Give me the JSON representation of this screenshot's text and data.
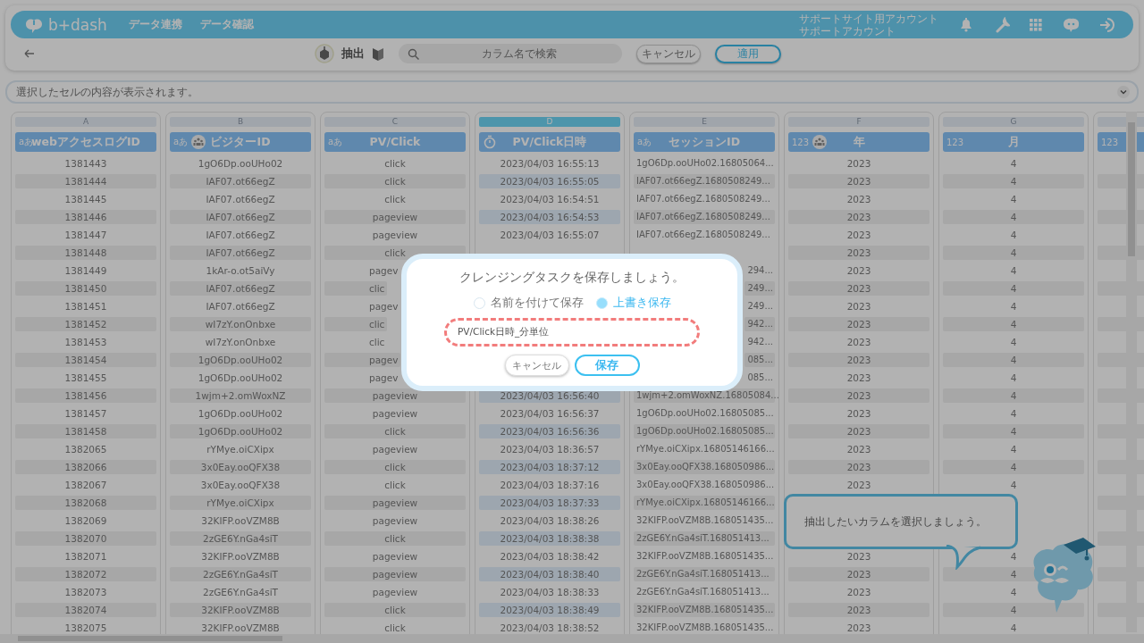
{
  "header": {
    "logo": "b+dash",
    "nav": [
      {
        "label": "データ連携"
      },
      {
        "label": "データ確認"
      }
    ],
    "account": [
      "サポートサイト用アカウント",
      "サポートアカウント"
    ]
  },
  "toolbar": {
    "mode_label": "抽出",
    "search": {
      "placeholder": "カラム名で検索"
    },
    "buttons": [
      {
        "label": "キャンセル",
        "kind": "secondary"
      },
      {
        "label": "適用",
        "kind": "primary"
      }
    ]
  },
  "cell_viewer": {
    "placeholder": "選択したセルの内容が表示されます。"
  },
  "table": {
    "columns": [
      {
        "letter": "A",
        "name": "webアクセスログID",
        "kind": "label",
        "type_label": "aあ",
        "key": false,
        "selected": false
      },
      {
        "letter": "B",
        "name": "ビジターID",
        "kind": "label",
        "type_label": "aあ",
        "key": true,
        "selected": false
      },
      {
        "letter": "C",
        "name": "PV/Click",
        "kind": "label",
        "type_label": "aあ",
        "key": false,
        "selected": false
      },
      {
        "letter": "D",
        "name": "PV/Click日時",
        "kind": "datetime",
        "key": false,
        "selected": true
      },
      {
        "letter": "E",
        "name": "セッションID",
        "kind": "label",
        "type_label": "aあ",
        "key": false,
        "selected": false
      },
      {
        "letter": "F",
        "name": "年",
        "kind": "label",
        "type_label": "123",
        "key": true,
        "selected": false
      },
      {
        "letter": "G",
        "name": "月",
        "kind": "label",
        "type_label": "123",
        "key": false,
        "selected": false
      },
      {
        "kind": "label",
        "type_label": "123",
        "key": false,
        "selected": false
      }
    ],
    "rows": [
      [
        "1381443",
        "1gO6Dp.ooUHo02",
        "click",
        "2023/04/03 16:55:13",
        "1gO6Dp.ooUHo02.16805064...",
        "2023",
        "4"
      ],
      [
        "1381444",
        "IAF07.ot66egZ",
        "click",
        "2023/04/03 16:55:05",
        "IAF07.ot66egZ.1680508249...",
        "2023",
        "4"
      ],
      [
        "1381445",
        "IAF07.ot66egZ",
        "click",
        "2023/04/03 16:54:51",
        "IAF07.ot66egZ.1680508249...",
        "2023",
        "4"
      ],
      [
        "1381446",
        "IAF07.ot66egZ",
        "pageview",
        "2023/04/03 16:54:53",
        "IAF07.ot66egZ.1680508249...",
        "2023",
        "4"
      ],
      [
        "1381447",
        "IAF07.ot66egZ",
        "pageview",
        "2023/04/03 16:55:07",
        "IAF07.ot66egZ.1680508249...",
        "2023",
        "4"
      ],
      [
        "1381448",
        "IAF07.ot66egZ",
        "click",
        null,
        null,
        "2023",
        "4"
      ],
      [
        "1381449",
        "1kAr-o.ot5aiVy",
        {
          "text": "pagev",
          "kind": "cut-right"
        },
        null,
        {
          "text": "294...",
          "kind": "cut-left"
        },
        "2023",
        "4"
      ],
      [
        "1381450",
        "IAF07.ot66egZ",
        {
          "text": "clic",
          "kind": "cut-right"
        },
        null,
        {
          "text": "249...",
          "kind": "cut-left"
        },
        "2023",
        "4"
      ],
      [
        "1381451",
        "IAF07.ot66egZ",
        {
          "text": "pagev",
          "kind": "cut-right"
        },
        null,
        {
          "text": "249...",
          "kind": "cut-left"
        },
        "2023",
        "4"
      ],
      [
        "1381452",
        "wI7zY.onOnbxe",
        {
          "text": "clic",
          "kind": "cut-right"
        },
        null,
        {
          "text": "942...",
          "kind": "cut-left"
        },
        "2023",
        "4"
      ],
      [
        "1381453",
        "wI7zY.onOnbxe",
        {
          "text": "clic",
          "kind": "cut-right"
        },
        null,
        {
          "text": "942...",
          "kind": "cut-left"
        },
        "2023",
        "4"
      ],
      [
        "1381454",
        "1gO6Dp.ooUHo02",
        {
          "text": "pagev",
          "kind": "cut-right"
        },
        null,
        {
          "text": "085...",
          "kind": "cut-left"
        },
        "2023",
        "4"
      ],
      [
        "1381455",
        "1gO6Dp.ooUHo02",
        {
          "text": "pagev",
          "kind": "cut-right"
        },
        null,
        {
          "text": "085...",
          "kind": "cut-left"
        },
        "2023",
        "4"
      ],
      [
        "1381456",
        "1wjm+2.omWoxNZ",
        "pageview",
        "2023/04/03 16:56:40",
        "1wjm+2.omWoxNZ.16805084...",
        "2023",
        "4"
      ],
      [
        "1381457",
        "1gO6Dp.ooUHo02",
        "pageview",
        "2023/04/03 16:56:37",
        "1gO6Dp.ooUHo02.16805085...",
        "2023",
        "4"
      ],
      [
        "1381458",
        "1gO6Dp.ooUHo02",
        "click",
        "2023/04/03 16:56:36",
        "1gO6Dp.ooUHo02.16805085...",
        "2023",
        "4"
      ],
      [
        "1382065",
        "rYMye.oiCXipx",
        "pageview",
        "2023/04/03 18:36:57",
        "rYMye.oiCXipx.16805146166...",
        "2023",
        "4"
      ],
      [
        "1382066",
        "3x0Eay.ooQFX38",
        "click",
        "2023/04/03 18:37:12",
        "3x0Eay.ooQFX38.168050986...",
        "2023",
        "4"
      ],
      [
        "1382067",
        "3x0Eay.ooQFX38",
        "click",
        "2023/04/03 18:37:16",
        "3x0Eay.ooQFX38.168050986...",
        "2023",
        "4"
      ],
      [
        "1382068",
        "rYMye.oiCXipx",
        "pageview",
        "2023/04/03 18:37:33",
        "rYMye.oiCXipx.16805146166...",
        null,
        null
      ],
      [
        "1382069",
        "32KIFP.ooVZM8B",
        "pageview",
        "2023/04/03 18:38:26",
        "32KIFP.ooVZM8B.168051435...",
        null,
        null
      ],
      [
        "1382070",
        "2zGE6Y.nGa4siT",
        "click",
        "2023/04/03 18:38:38",
        "2zGE6Y.nGa4siT.168051413...",
        null,
        null
      ],
      [
        "1382071",
        "32KIFP.ooVZM8B",
        "pageview",
        "2023/04/03 18:38:42",
        "32KIFP.ooVZM8B.168051435...",
        "2023",
        "4"
      ],
      [
        "1382072",
        "2zGE6Y.nGa4siT",
        "pageview",
        "2023/04/03 18:38:40",
        "2zGE6Y.nGa4siT.168051413...",
        "2023",
        "4"
      ],
      [
        "1382073",
        "2zGE6Y.nGa4siT",
        "pageview",
        "2023/04/03 18:38:33",
        "2zGE6Y.nGa4siT.168051413...",
        "2023",
        "4"
      ],
      [
        "1382074",
        "32KIFP.ooVZM8B",
        "click",
        "2023/04/03 18:38:49",
        "32KIFP.ooVZM8B.168051435...",
        "2023",
        "4"
      ],
      [
        "1382075",
        "32KIFP.ooVZM8B",
        "click",
        "2023/04/03 18:38:52",
        "32KIFP.ooVZM8B.168051435...",
        "2023",
        "4"
      ]
    ]
  },
  "tip": {
    "text": "抽出したいカラムを選択しましょう。"
  },
  "dialog": {
    "title": "クレンジングタスクを保存しましょう。",
    "options": [
      {
        "label": "名前を付けて保存",
        "selected": false
      },
      {
        "label": "上書き保存",
        "selected": true
      }
    ],
    "field": {
      "value": "PV/Click日時_分単位"
    },
    "buttons": [
      {
        "label": "キャンセル",
        "kind": "secondary"
      },
      {
        "label": "保存",
        "kind": "primary"
      }
    ]
  }
}
